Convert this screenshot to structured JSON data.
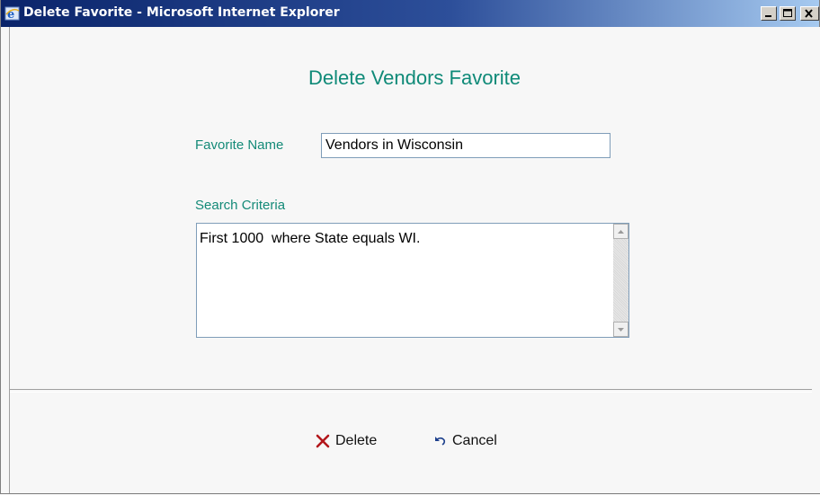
{
  "window": {
    "title": "Delete Favorite - Microsoft Internet Explorer"
  },
  "page": {
    "heading": "Delete Vendors Favorite"
  },
  "form": {
    "name_label": "Favorite Name",
    "name_value": "Vendors in Wisconsin",
    "criteria_label": "Search Criteria",
    "criteria_value": "First 1000  where State equals WI."
  },
  "actions": {
    "delete_label": "Delete",
    "cancel_label": "Cancel"
  },
  "icons": {
    "app": "ie-icon",
    "delete": "x-icon",
    "cancel": "undo-arrow-icon"
  },
  "colors": {
    "accent_text": "#0f8a78",
    "delete_icon": "#b3161b",
    "cancel_icon": "#1c3f8c",
    "titlebar": "#0a246a"
  }
}
